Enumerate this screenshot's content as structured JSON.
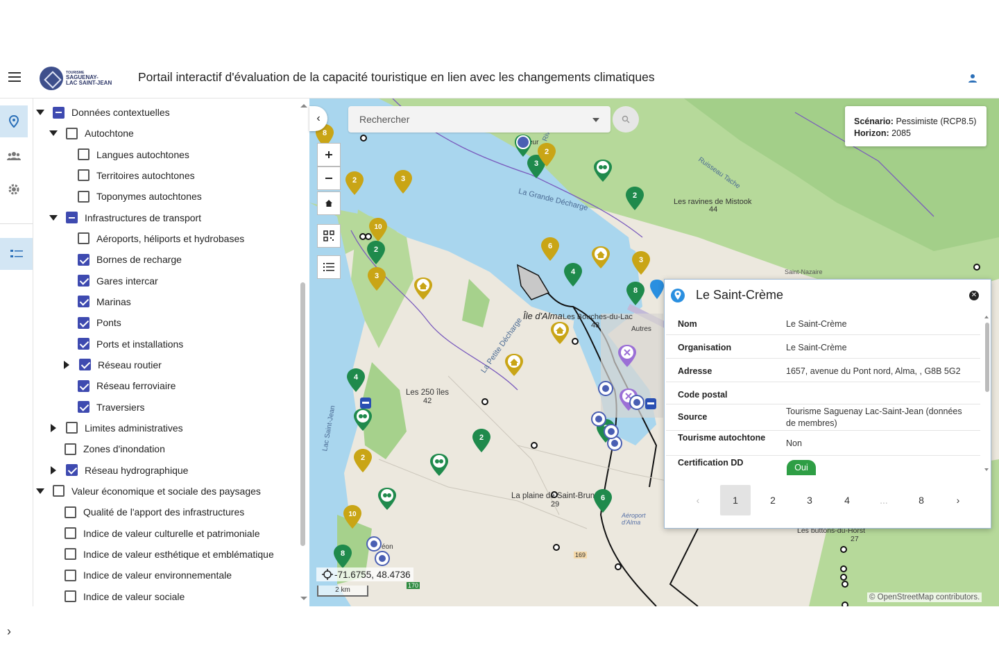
{
  "header": {
    "logo_line1": "TOURISME",
    "logo_line2": "SAGUENAY-",
    "logo_line3": "LAC SAINT-JEAN",
    "title": "Portail interactif d'évaluation de la capacité touristique en lien avec les changements climatiques"
  },
  "rail": {
    "expand_glyph": "›"
  },
  "tree": {
    "items": [
      {
        "label": "Données contextuelles",
        "level": 0,
        "caret": "down",
        "check": "partial"
      },
      {
        "label": "Autochtone",
        "level": 1,
        "caret": "down",
        "check": "none"
      },
      {
        "label": "Langues autochtones",
        "level": 2,
        "caret": "none",
        "check": "none"
      },
      {
        "label": "Territoires autochtones",
        "level": 2,
        "caret": "none",
        "check": "none"
      },
      {
        "label": "Toponymes autochtones",
        "level": 2,
        "caret": "none",
        "check": "none"
      },
      {
        "label": "Infrastructures de transport",
        "level": 1,
        "caret": "down",
        "check": "partial"
      },
      {
        "label": "Aéroports, héliports et hydrobases",
        "level": 2,
        "caret": "none",
        "check": "none"
      },
      {
        "label": "Bornes de recharge",
        "level": 2,
        "caret": "none",
        "check": "checked"
      },
      {
        "label": "Gares intercar",
        "level": 2,
        "caret": "none",
        "check": "checked"
      },
      {
        "label": "Marinas",
        "level": 2,
        "caret": "none",
        "check": "checked"
      },
      {
        "label": "Ponts",
        "level": 2,
        "caret": "none",
        "check": "checked"
      },
      {
        "label": "Ports et installations",
        "level": 2,
        "caret": "none",
        "check": "checked"
      },
      {
        "label": "Réseau routier",
        "level": 2,
        "caret": "right",
        "check": "checked"
      },
      {
        "label": "Réseau ferroviaire",
        "level": 2,
        "caret": "none",
        "check": "checked"
      },
      {
        "label": "Traversiers",
        "level": 2,
        "caret": "none",
        "check": "checked"
      },
      {
        "label": "Limites administratives",
        "level": 1,
        "caret": "right",
        "check": "none"
      },
      {
        "label": "Zones d'inondation",
        "level": 1,
        "caret": "none",
        "check": "none"
      },
      {
        "label": "Réseau hydrographique",
        "level": 1,
        "caret": "right",
        "check": "checked"
      },
      {
        "label": "Valeur économique et sociale des paysages",
        "level": 0,
        "caret": "down",
        "check": "none"
      },
      {
        "label": "Qualité de l'apport des infrastructures",
        "level": 1,
        "caret": "none",
        "check": "none"
      },
      {
        "label": "Indice de valeur culturelle et patrimoniale",
        "level": 1,
        "caret": "none",
        "check": "none"
      },
      {
        "label": "Indice de valeur esthétique et emblématique",
        "level": 1,
        "caret": "none",
        "check": "none"
      },
      {
        "label": "Indice de valeur environnementale",
        "level": 1,
        "caret": "none",
        "check": "none"
      },
      {
        "label": "Indice de valeur sociale",
        "level": 1,
        "caret": "none",
        "check": "none"
      }
    ]
  },
  "map": {
    "search_placeholder": "Rechercher",
    "scenario_label": "Scénario:",
    "scenario_value": "Pessimiste (RCP8.5)",
    "horizon_label": "Horizon:",
    "horizon_value": "2085",
    "coordinates": "-71.6755, 48.4736",
    "scale": "2 km",
    "attribution": "© OpenStreetMap contributors.",
    "place_labels": {
      "la_grande_decharge": "La Grande Décharge",
      "ravines": "Les ravines de Mistook",
      "ravines_num": "44",
      "ile_dalma": "Île d'Alma",
      "bouches": "Les Bouches-du-Lac",
      "bouches_num": "43",
      "petite_decharge": "La Petite Décharge",
      "iles": "Les 250 îles",
      "iles_num": "42",
      "lac_st_jean": "Lac Saint-Jean",
      "plaine": "La plaine de Saint-Bruno",
      "plaine_num": "29",
      "buttons": "Les buttons-du-Horst",
      "buttons_num": "27",
      "aeroport": "Aéroport d'Alma",
      "autres": "Autres",
      "saint_nazaire": "Saint-Nazaire",
      "route_169": "169",
      "route_170": "170",
      "leon": "éon",
      "ruisseau_tache": "Ruisseau Tache",
      "riviere": "Rivi",
      "eur": "eur"
    },
    "markers": [
      {
        "label": "8",
        "color": "#c9a516"
      },
      {
        "label": "2",
        "color": "#c9a516"
      },
      {
        "label": "3",
        "color": "#c9a516"
      },
      {
        "label": "3",
        "color": "#1f8a4c"
      },
      {
        "label": "2",
        "color": "#c9a516"
      },
      {
        "label": "2",
        "color": "#1f8a4c"
      },
      {
        "label": "10",
        "color": "#c9a516"
      },
      {
        "label": "2",
        "color": "#1f8a4c"
      },
      {
        "label": "3",
        "color": "#c9a516"
      },
      {
        "label": "6",
        "color": "#c9a516"
      },
      {
        "label": "4",
        "color": "#1f8a4c"
      },
      {
        "label": "3",
        "color": "#c9a516"
      },
      {
        "label": "8",
        "color": "#1f8a4c"
      },
      {
        "label": "4",
        "color": "#1f8a4c"
      },
      {
        "label": "2",
        "color": "#1f8a4c"
      },
      {
        "label": "2",
        "color": "#c9a516"
      },
      {
        "label": "10",
        "color": "#c9a516"
      },
      {
        "label": "8",
        "color": "#1f8a4c"
      },
      {
        "label": "6",
        "color": "#1f8a4c"
      },
      {
        "label": "2",
        "color": "#1f8a4c"
      }
    ]
  },
  "popup": {
    "title": "Le Saint-Crème",
    "rows": [
      {
        "label": "Nom",
        "value": "Le Saint-Crème"
      },
      {
        "label": "Organisation",
        "value": "Le Saint-Crème"
      },
      {
        "label": "Adresse",
        "value": "1657, avenue du Pont nord, Alma, , G8B 5G2"
      },
      {
        "label": "Code postal",
        "value": ""
      },
      {
        "label": "Source",
        "value": "Tourisme Saguenay Lac-Saint-Jean (données de membres)"
      },
      {
        "label": "Tourisme autochtone",
        "value": "Non"
      },
      {
        "label": "Certification DD",
        "value": "Oui"
      }
    ],
    "pages": [
      "1",
      "2",
      "3",
      "4",
      "...",
      "8"
    ],
    "current_page": "1"
  },
  "colors": {
    "accent": "#3e4ab0",
    "water": "#a9d6ee",
    "forest": "#a6d18c",
    "yellow_marker": "#c9a516",
    "green_marker": "#1f8a4c",
    "purple_marker": "#9b6fd6",
    "blue_marker": "#4a5fb3",
    "popup_pin": "#2a8fe0",
    "badge_green": "#2e9e45"
  },
  "icons": {
    "menu": "hamburger-icon",
    "user": "user-icon",
    "rail": [
      "map-pin-icon",
      "people-icon",
      "gear-icon",
      "layers-list-icon"
    ],
    "search": "search-icon",
    "zoom_in": "plus-icon",
    "zoom_out": "minus-icon",
    "home": "home-icon",
    "qr": "qr-code-icon",
    "list": "list-icon",
    "crosshair": "crosshair-icon",
    "close": "close-icon"
  }
}
